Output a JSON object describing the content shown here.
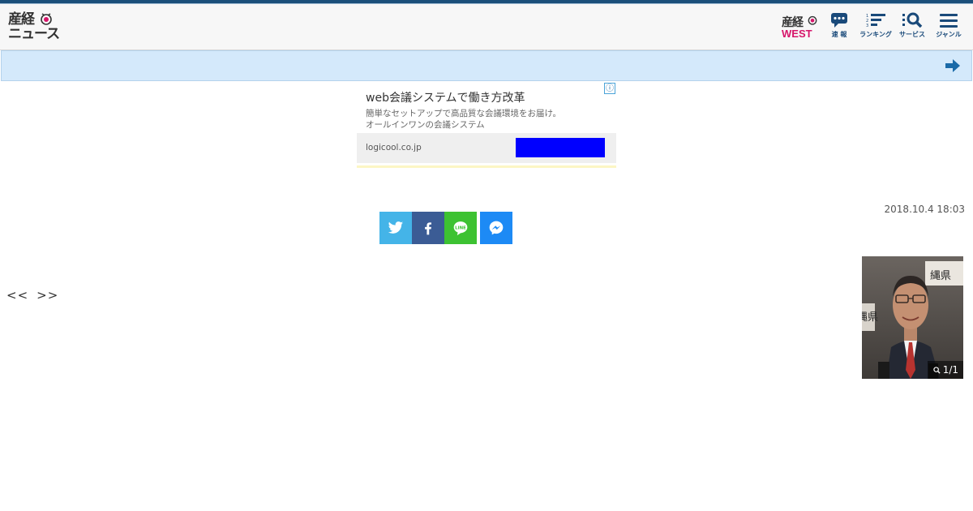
{
  "header": {
    "logo_line1": "産経",
    "logo_line2": "ニュース",
    "west_logo_top": "産経",
    "west_logo_bottom": "WEST",
    "nav": [
      {
        "label": "速 報",
        "icon": "speech-bubble-icon"
      },
      {
        "label": "ランキング",
        "icon": "ranking-list-icon"
      },
      {
        "label": "サービス",
        "icon": "service-search-icon"
      },
      {
        "label": "ジャンル",
        "icon": "hamburger-menu-icon"
      }
    ],
    "accent_color": "#1b4f7a"
  },
  "banner": {
    "icon": "arrow-right-icon",
    "color": "#d4e9fb"
  },
  "ad": {
    "title": "web会議システムで働き方改革",
    "description_line1": "簡単なセットアップで高品質な会議環境をお届け。",
    "description_line2": "オールインワンの会議システム",
    "domain": "logicool.co.jp",
    "info_icon": "ⓘ",
    "cta_color": "#0000ff"
  },
  "article": {
    "date": "2018.10.4 18:03"
  },
  "share": [
    {
      "name": "twitter",
      "icon": "twitter-icon",
      "color": "#44b4e8"
    },
    {
      "name": "facebook",
      "icon": "facebook-icon",
      "color": "#3b5c95"
    },
    {
      "name": "line",
      "icon": "line-icon",
      "label": "LINE",
      "color": "#3dc232"
    },
    {
      "name": "messenger",
      "icon": "messenger-icon",
      "color": "#1d8af5"
    }
  ],
  "pager": {
    "prev": "<<",
    "next": ">>"
  },
  "photo": {
    "counter": "1/1",
    "zoom_icon": "magnifier-icon",
    "sign_text_top": "縄県",
    "sign_text_left": "縄県"
  }
}
